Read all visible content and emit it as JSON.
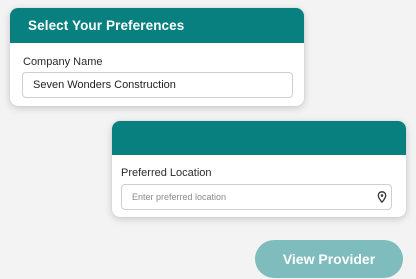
{
  "preferences_card": {
    "title": "Select Your Preferences",
    "company_name_label": "Company Name",
    "company_name_value": "Seven Wonders Construction",
    "header_color": "#098080"
  },
  "location_card": {
    "title": "",
    "preferred_location_label": "Preferred Location",
    "preferred_location_value": "",
    "preferred_location_placeholder": "Enter preferred location",
    "location_icon": "map-pin-icon",
    "header_color": "#098080"
  },
  "actions": {
    "view_provider_label": "View Provider",
    "view_provider_color": "#7ebcbe",
    "view_provider_state": "disabled"
  }
}
